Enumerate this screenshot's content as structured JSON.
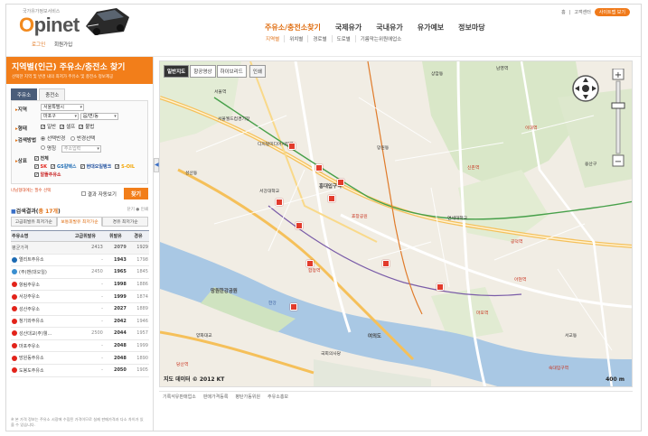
{
  "header": {
    "logo_sub": "국가유가정보서비스",
    "logo_o": "O",
    "logo_rest": "pinet",
    "login": "로그인",
    "join": "회원가입",
    "util": {
      "home": "홈",
      "customer": "고객센터",
      "sitemap": "사이트맵 보기"
    },
    "nav": [
      "주유소/충전소찾기",
      "국제유가",
      "국내유가",
      "유가예보",
      "정보마당"
    ],
    "subnav": [
      "지역별",
      "위치별",
      "경로별",
      "도로별",
      "기름막는위원에업소"
    ]
  },
  "sidebar": {
    "title": "지역별(인근) 주유소/충전소 찾기",
    "desc": "선택한 지역 및 반경 내의 최저가 주유소 및 충전소 정보제공",
    "tabs": [
      "주유소",
      "충전소"
    ],
    "region_label": "지역",
    "region_city": "서울특별시",
    "region_gu": "마포구",
    "region_dong": "읍/면/동",
    "type_label": "형태",
    "types": [
      "일반",
      "셀프",
      "불법"
    ],
    "search_method_label": "검색방법",
    "method_radius": "선택반경",
    "method_radius_alt": "반경선택",
    "method_addr": "명칭",
    "addr_placeholder": "주소입력",
    "brand_label": "상표",
    "brand_all": "전체",
    "brands": [
      "SK",
      "GS칼텍스",
      "현대오일뱅크",
      "S-OIL",
      "알뜰주유소"
    ],
    "note": "너님형대에는 필수 선택",
    "result_auto": "결과 자동보기",
    "search_btn": "찾기",
    "results_title_prefix": "검색결과",
    "results_count": "총 17개",
    "results_tools": "닫기 ● 인쇄",
    "sort_tabs": [
      "고급휘발유 최저가순",
      "보통휘발유 최저가순",
      "경유 최저가순"
    ],
    "table_headers": [
      "주유소명",
      "고급휘발유",
      "휘발유",
      "경유"
    ],
    "avg_row": {
      "name": "평균가격",
      "premium": "2413",
      "gasoline": "2079",
      "diesel": "1929"
    },
    "rows": [
      {
        "name": "엘리트주유소",
        "premium": "-",
        "gasoline": "1943",
        "diesel": "1798",
        "color": "#1b6ab3"
      },
      {
        "name": "(주)밴(대오일)",
        "premium": "2450",
        "gasoline": "1965",
        "diesel": "1845",
        "color": "#3a8fd0"
      },
      {
        "name": "항림주유소",
        "premium": "-",
        "gasoline": "1998",
        "diesel": "1886",
        "color": "#e2231a"
      },
      {
        "name": "서강주유소",
        "premium": "-",
        "gasoline": "1999",
        "diesel": "1874",
        "color": "#e2231a"
      },
      {
        "name": "성산주유소",
        "premium": "-",
        "gasoline": "2027",
        "diesel": "1889",
        "color": "#e2231a"
      },
      {
        "name": "청기와주유소",
        "premium": "-",
        "gasoline": "2042",
        "diesel": "1946",
        "color": "#e2231a"
      },
      {
        "name": "성산대교(주)웰...",
        "premium": "2500",
        "gasoline": "2044",
        "diesel": "1957",
        "color": "#e2231a"
      },
      {
        "name": "마포주유소",
        "premium": "-",
        "gasoline": "2048",
        "diesel": "1999",
        "color": "#e2231a"
      },
      {
        "name": "망원동주유소",
        "premium": "-",
        "gasoline": "2048",
        "diesel": "1890",
        "color": "#e2231a"
      },
      {
        "name": "도봉도주유소",
        "premium": "-",
        "gasoline": "2050",
        "diesel": "1905",
        "color": "#e2231a"
      }
    ],
    "foot_note": "※ 본 가격 정보는 주유소 시장에 수집된 가격이므로 실제 판매가격과 다소 차이가 있을 수 있습니다."
  },
  "map": {
    "types": [
      "일반지도",
      "항공영상",
      "하이브리드"
    ],
    "print": "인쇄",
    "copyright": "지도 데이터 © 2012 KT",
    "scale": "400 m",
    "labels": [
      "서울월드컵경기장",
      "망원한강공원",
      "한강",
      "양화대교",
      "합정역",
      "홍대입구역",
      "신촌역",
      "이대역",
      "아현역",
      "공덕역",
      "마포역",
      "여의도",
      "국회의사당",
      "디지털미디어시티역",
      "상암동",
      "연세대학교",
      "서강대학교",
      "성산동",
      "망원동",
      "서교동",
      "용산구",
      "효창공원",
      "서울역",
      "남영역",
      "숙대입구역",
      "동교동",
      "연희동",
      "대흥동",
      "산천동",
      "당산역"
    ]
  },
  "footer": [
    "기록석유판매업소",
    "판매가격등록",
    "평탄가동위원",
    "주유소홍보"
  ]
}
